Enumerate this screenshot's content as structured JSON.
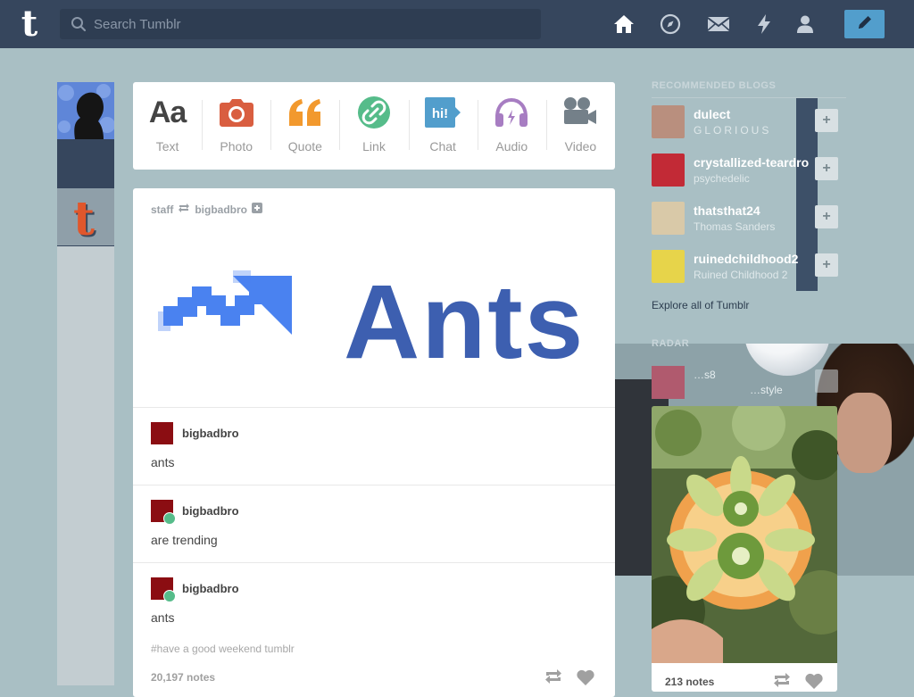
{
  "topbar": {
    "logo_letter": "t",
    "search_placeholder": "Search Tumblr",
    "nav_icons": [
      "home-icon",
      "explore-compass-icon",
      "inbox-mail-icon",
      "activity-bolt-icon",
      "account-person-icon"
    ],
    "compose_icon": "pencil-icon",
    "colors": {
      "bar": "#36465d",
      "compose": "#529ecc"
    }
  },
  "post_types": [
    {
      "label": "Text",
      "icon": "text-aa-icon",
      "color": "#444444"
    },
    {
      "label": "Photo",
      "icon": "camera-icon",
      "color": "#d95e40"
    },
    {
      "label": "Quote",
      "icon": "quote-icon",
      "color": "#f2992e"
    },
    {
      "label": "Link",
      "icon": "link-icon",
      "color": "#56bc8a"
    },
    {
      "label": "Chat",
      "icon": "chat-bubble-icon",
      "color": "#529ecc"
    },
    {
      "label": "Audio",
      "icon": "headphones-icon",
      "color": "#a77dc2"
    },
    {
      "label": "Video",
      "icon": "video-camera-icon",
      "color": "#748089"
    }
  ],
  "post": {
    "header": {
      "reblogger": "staff",
      "source": "bigbadbro"
    },
    "banner_text": "Ants",
    "thread": [
      {
        "name": "bigbadbro",
        "text": "ants",
        "reblog_badge": false
      },
      {
        "name": "bigbadbro",
        "text": "are trending",
        "reblog_badge": true
      },
      {
        "name": "bigbadbro",
        "text": "ants",
        "reblog_badge": true
      }
    ],
    "tags": "#have a good weekend tumblr",
    "notes": "20,197 notes"
  },
  "sidebar": {
    "recommended_title": "RECOMMENDED BLOGS",
    "blogs": [
      {
        "name": "dulect",
        "subtitle": "GLORIOUS",
        "avatar_color": "#b98f7e"
      },
      {
        "name": "crystallized-teardrops",
        "subtitle": "psychedelic",
        "avatar_color": "#c22a36"
      },
      {
        "name": "thatsthat24",
        "subtitle": "Thomas Sanders",
        "avatar_color": "#d9c9a8"
      },
      {
        "name": "ruinedchildhood2",
        "subtitle": "Ruined Childhood 2",
        "avatar_color": "#e7d44a"
      }
    ],
    "explore_link": "Explore all of Tumblr",
    "radar_title": "RADAR",
    "radar": {
      "name": "…s8",
      "subtitle": "…style",
      "notes": "213 notes"
    }
  }
}
